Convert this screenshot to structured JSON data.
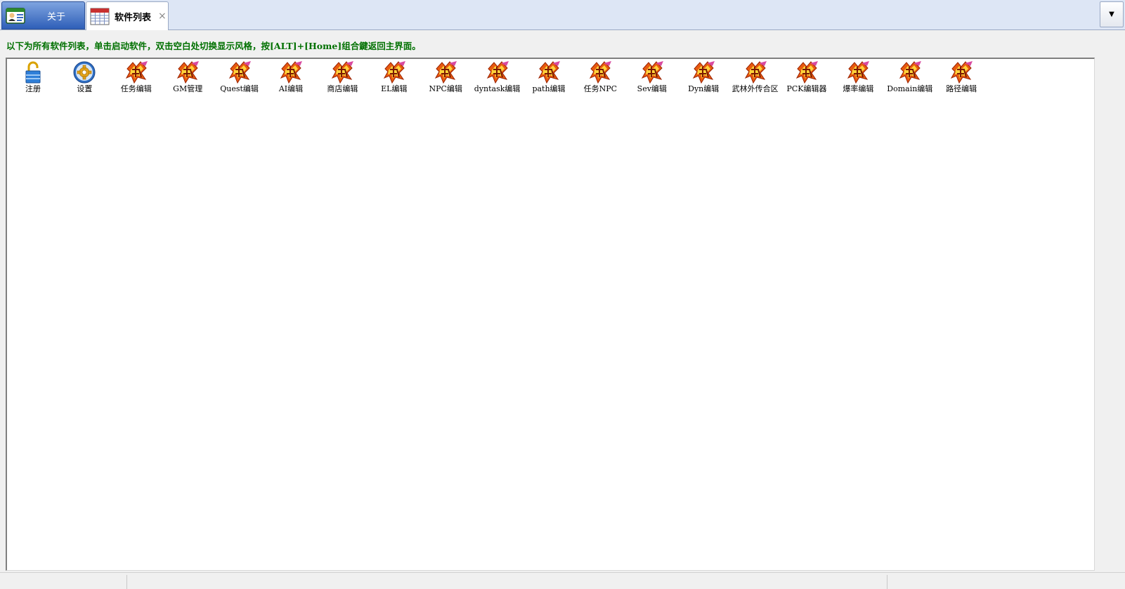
{
  "tabs": [
    {
      "label": "关于",
      "icon": "user-card-icon",
      "active": false
    },
    {
      "label": "软件列表",
      "icon": "calendar-table-icon",
      "active": true,
      "close": "×"
    }
  ],
  "overflow_button": "▼",
  "hint": "以下为所有软件列表，单击启动软件，双击空白处切换显示风格，按[ALT]+[Home]组合鍵返回主界面。",
  "colors": {
    "hint_text": "#007000",
    "tab_active_bg": "#ffffff",
    "tab_inactive_bg": "#3a6cc4"
  },
  "items": [
    {
      "label": "注册",
      "icon": "lock-icon"
    },
    {
      "label": "设置",
      "icon": "gear-icon"
    },
    {
      "label": "任务编辑",
      "icon": "wulin-logo-icon"
    },
    {
      "label": "GM管理",
      "icon": "wulin-logo-icon"
    },
    {
      "label": "Quest编辑",
      "icon": "wulin-logo-icon"
    },
    {
      "label": "AI编辑",
      "icon": "wulin-logo-icon"
    },
    {
      "label": "商店编辑",
      "icon": "wulin-logo-icon"
    },
    {
      "label": "EL编辑",
      "icon": "wulin-logo-icon"
    },
    {
      "label": "NPC编辑",
      "icon": "wulin-logo-icon"
    },
    {
      "label": "dyntask编辑",
      "icon": "wulin-logo-icon"
    },
    {
      "label": "path编辑",
      "icon": "wulin-logo-icon"
    },
    {
      "label": "任务NPC",
      "icon": "wulin-logo-icon"
    },
    {
      "label": "Sev编辑",
      "icon": "wulin-logo-icon"
    },
    {
      "label": "Dyn编辑",
      "icon": "wulin-logo-icon"
    },
    {
      "label": "武林外传合区",
      "icon": "wulin-logo-icon"
    },
    {
      "label": "PCK编辑器",
      "icon": "wulin-logo-icon"
    },
    {
      "label": "爆率编辑",
      "icon": "wulin-logo-icon"
    },
    {
      "label": "Domain编辑",
      "icon": "wulin-logo-icon"
    },
    {
      "label": "路径编辑",
      "icon": "wulin-logo-icon"
    }
  ]
}
